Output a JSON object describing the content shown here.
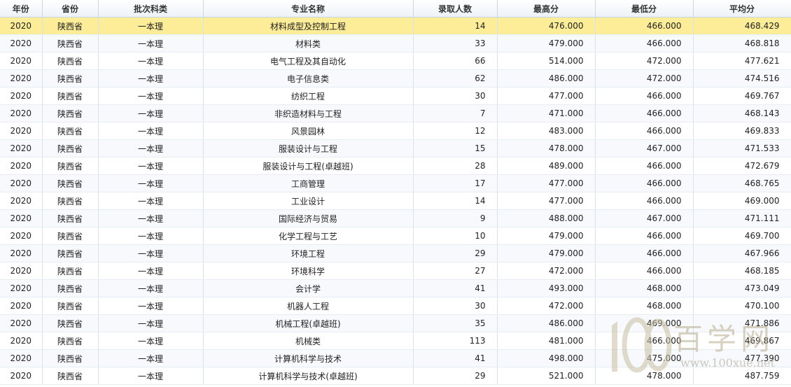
{
  "columns": [
    "年份",
    "省份",
    "批次科类",
    "专业名称",
    "录取人数",
    "最高分",
    "最低分",
    "平均分"
  ],
  "rows": [
    [
      "2020",
      "陕西省",
      "一本理",
      "材料成型及控制工程",
      "14",
      "476.000",
      "466.000",
      "468.429"
    ],
    [
      "2020",
      "陕西省",
      "一本理",
      "材料类",
      "33",
      "479.000",
      "466.000",
      "468.818"
    ],
    [
      "2020",
      "陕西省",
      "一本理",
      "电气工程及其自动化",
      "66",
      "514.000",
      "472.000",
      "477.621"
    ],
    [
      "2020",
      "陕西省",
      "一本理",
      "电子信息类",
      "62",
      "486.000",
      "472.000",
      "474.516"
    ],
    [
      "2020",
      "陕西省",
      "一本理",
      "纺织工程",
      "30",
      "477.000",
      "466.000",
      "469.767"
    ],
    [
      "2020",
      "陕西省",
      "一本理",
      "非织造材料与工程",
      "7",
      "471.000",
      "466.000",
      "468.143"
    ],
    [
      "2020",
      "陕西省",
      "一本理",
      "风景园林",
      "12",
      "483.000",
      "466.000",
      "469.833"
    ],
    [
      "2020",
      "陕西省",
      "一本理",
      "服装设计与工程",
      "15",
      "478.000",
      "467.000",
      "471.533"
    ],
    [
      "2020",
      "陕西省",
      "一本理",
      "服装设计与工程(卓越班)",
      "28",
      "489.000",
      "466.000",
      "472.679"
    ],
    [
      "2020",
      "陕西省",
      "一本理",
      "工商管理",
      "17",
      "477.000",
      "466.000",
      "468.765"
    ],
    [
      "2020",
      "陕西省",
      "一本理",
      "工业设计",
      "14",
      "477.000",
      "466.000",
      "469.000"
    ],
    [
      "2020",
      "陕西省",
      "一本理",
      "国际经济与贸易",
      "9",
      "488.000",
      "467.000",
      "471.111"
    ],
    [
      "2020",
      "陕西省",
      "一本理",
      "化学工程与工艺",
      "10",
      "479.000",
      "466.000",
      "469.700"
    ],
    [
      "2020",
      "陕西省",
      "一本理",
      "环境工程",
      "29",
      "479.000",
      "466.000",
      "467.966"
    ],
    [
      "2020",
      "陕西省",
      "一本理",
      "环境科学",
      "27",
      "472.000",
      "466.000",
      "468.185"
    ],
    [
      "2020",
      "陕西省",
      "一本理",
      "会计学",
      "41",
      "493.000",
      "468.000",
      "473.049"
    ],
    [
      "2020",
      "陕西省",
      "一本理",
      "机器人工程",
      "30",
      "472.000",
      "468.000",
      "470.100"
    ],
    [
      "2020",
      "陕西省",
      "一本理",
      "机械工程(卓越班)",
      "35",
      "486.000",
      "469.000",
      "471.886"
    ],
    [
      "2020",
      "陕西省",
      "一本理",
      "机械类",
      "113",
      "481.000",
      "466.000",
      "469.867"
    ],
    [
      "2020",
      "陕西省",
      "一本理",
      "计算机科学与技术",
      "41",
      "498.000",
      "475.000",
      "477.390"
    ],
    [
      "2020",
      "陕西省",
      "一本理",
      "计算机科学与技术(卓越班)",
      "29",
      "521.000",
      "478.000",
      "487.759"
    ]
  ],
  "selected_row": 0,
  "watermark": {
    "text": "百学网",
    "url": "www.100xue.net"
  }
}
